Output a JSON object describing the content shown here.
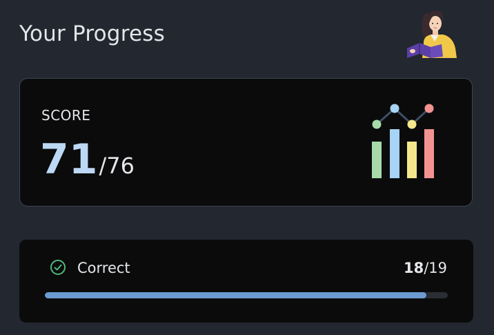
{
  "header": {
    "title": "Your Progress",
    "avatar_icon": "reading-person-icon"
  },
  "score_card": {
    "label": "SCORE",
    "score": "71",
    "separator": "/",
    "total": "76",
    "icon": "bar-line-chart-icon",
    "score_color": "#bcd8f4"
  },
  "correct_card": {
    "label": "Correct",
    "icon": "check-circle-icon",
    "count": "18",
    "separator": "/",
    "total": "19",
    "progress_fraction": 0.947,
    "progress_color": "#6b9bd0",
    "check_color": "#4fb97a"
  }
}
